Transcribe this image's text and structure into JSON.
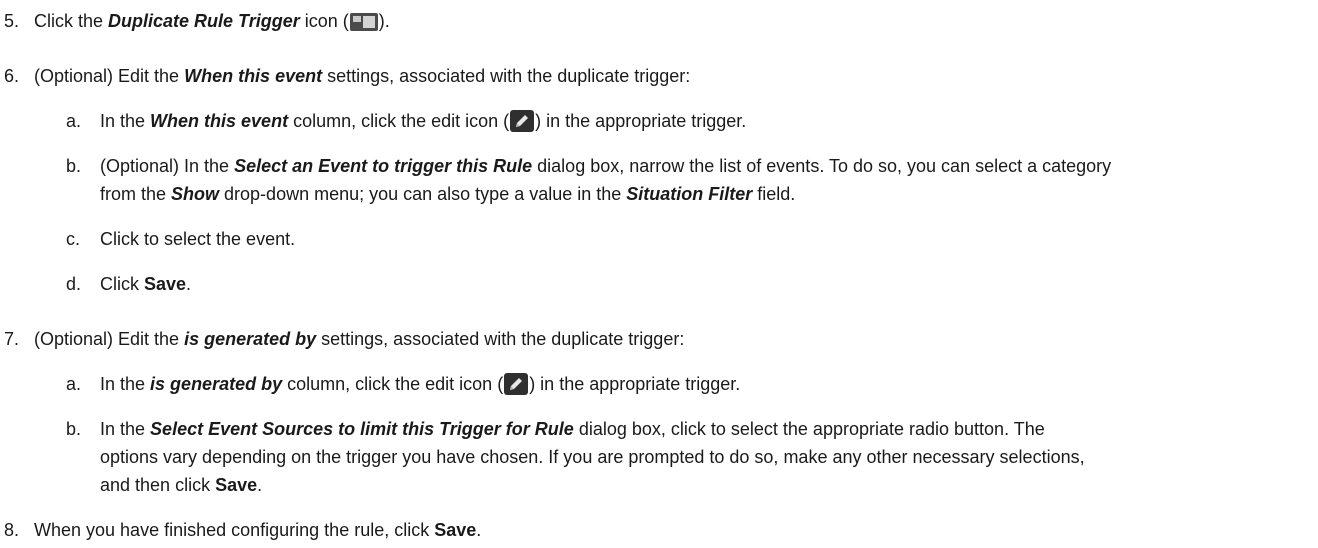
{
  "steps": [
    {
      "num": "5.",
      "parts": [
        "Click the ",
        "Duplicate Rule Trigger",
        " icon (",
        ")."
      ]
    },
    {
      "num": "6.",
      "parts": [
        "(Optional) Edit the ",
        "When this event",
        " settings, associated with the duplicate trigger:"
      ],
      "subs": [
        {
          "letter": "a.",
          "parts": [
            "In the ",
            "When this event",
            " column, click the edit icon (",
            ") in the appropriate trigger."
          ]
        },
        {
          "letter": "b.",
          "parts": [
            "(Optional) In the ",
            "Select an Event to trigger this Rule",
            " dialog box, narrow the list of events. To do so, you can select a category"
          ],
          "cont": [
            "from the ",
            "Show",
            " drop-down menu; you can also type a value in the ",
            "Situation Filter",
            " field."
          ]
        },
        {
          "letter": "c.",
          "text": "Click to select the event."
        },
        {
          "letter": "d.",
          "parts": [
            "Click ",
            "Save",
            "."
          ]
        }
      ]
    },
    {
      "num": "7.",
      "parts": [
        "(Optional) Edit the ",
        "is generated by",
        " settings, associated with the duplicate trigger:"
      ],
      "subs": [
        {
          "letter": "a.",
          "parts": [
            "In the ",
            "is generated by",
            " column, click the edit icon (",
            ") in the appropriate trigger."
          ]
        },
        {
          "letter": "b.",
          "parts": [
            "In the ",
            "Select Event Sources to limit this Trigger for Rule",
            " dialog box, click to select the appropriate radio button. The"
          ],
          "cont1": "options vary depending on the trigger you have chosen. If you are prompted to do so, make any other necessary selections,",
          "cont2": [
            "and then click ",
            "Save",
            "."
          ]
        }
      ]
    },
    {
      "num": "8.",
      "parts": [
        "When you have finished configuring the rule, click ",
        "Save",
        "."
      ]
    }
  ]
}
